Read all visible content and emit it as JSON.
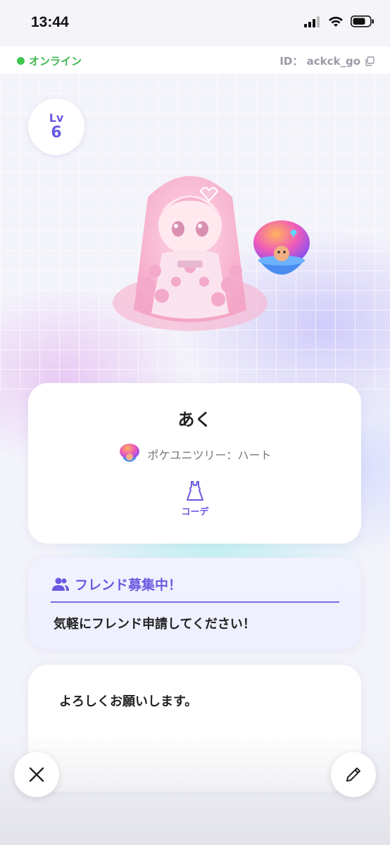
{
  "status_bar": {
    "time": "13:44"
  },
  "topbar": {
    "online_label": "オンライン",
    "user_id": "ID： ackck_go"
  },
  "profile": {
    "level_label": "Lv",
    "level_value": "6",
    "username": "あく",
    "tree": "ポケユニツリー：ハート",
    "outfit_label": "コーデ"
  },
  "friend": {
    "title": "フレンド募集中！",
    "message": "気軽にフレンド申請してください！"
  },
  "message": {
    "text": "よろしくお願いします。"
  },
  "colors": {
    "accent": "#6a5ae0",
    "online": "#3fc64f"
  }
}
